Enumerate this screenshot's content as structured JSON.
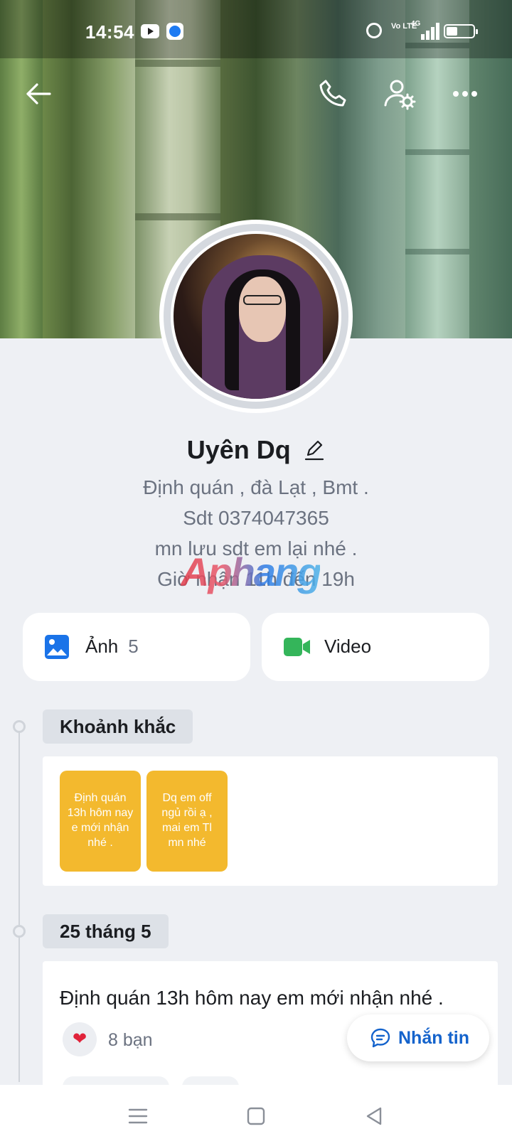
{
  "status_bar": {
    "time": "14:54",
    "signal_label": "4G",
    "volte_label": "Vo LTE"
  },
  "profile": {
    "name": "Uyên Dq",
    "bio_lines": [
      "Định quán , đà Lạt , Bmt .",
      "Sdt 0374047365",
      "mn lưu sdt em lại nhé .",
      "Giờ nhận 11h đến 19h"
    ]
  },
  "watermark": "Aphang",
  "media_cards": {
    "photos": {
      "label": "Ảnh",
      "count": "5",
      "icon": "image-icon",
      "color": "#1a73e8"
    },
    "videos": {
      "label": "Video",
      "icon": "video-camera-icon",
      "color": "#34b55a"
    }
  },
  "timeline": {
    "moments_label": "Khoảnh khắc",
    "stories": [
      {
        "text": "Định quán 13h hôm nay e mới nhận nhé ."
      },
      {
        "text": "Dq em off ngủ rồi ạ , mai em Tl mn nhé"
      }
    ],
    "date_label": "25 tháng 5",
    "post": {
      "text": "Định quán 13h hôm nay em mới nhận nhé .",
      "like_icon": "heart-icon",
      "like_count": "8 bạn"
    }
  },
  "message_button": {
    "label": "Nhắn tin"
  },
  "colors": {
    "accent": "#1463cc",
    "story_bg": "#f3b92e",
    "background": "#eef0f4"
  }
}
